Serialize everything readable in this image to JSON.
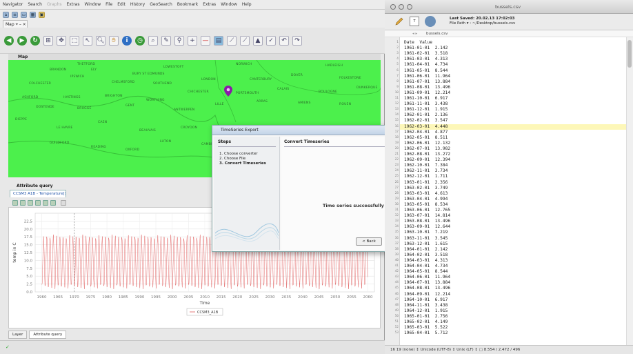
{
  "left_app": {
    "menu": [
      {
        "label": "Navigator",
        "dim": false
      },
      {
        "label": "Search",
        "dim": false
      },
      {
        "label": "Graphs",
        "dim": true
      },
      {
        "label": "Extras",
        "dim": false
      },
      {
        "label": "Window",
        "dim": false
      },
      {
        "label": "File",
        "dim": false
      },
      {
        "label": "Edit",
        "dim": false
      },
      {
        "label": "History",
        "dim": false
      },
      {
        "label": "GeoSearch",
        "dim": false
      },
      {
        "label": "Bookmark",
        "dim": false
      },
      {
        "label": "Extras",
        "dim": false
      },
      {
        "label": "Window",
        "dim": false
      },
      {
        "label": "Help",
        "dim": false
      }
    ],
    "map_tab_label": "Map ⌖ – ×",
    "map_panel_title": "Map",
    "map_places": [
      "THETFORD",
      "LOWESTOFT",
      "NORWICH",
      "HADLEIGH",
      "BRANDON",
      "ELY",
      "BURY ST EDMUNDS",
      "IPSWICH",
      "COLCHESTER",
      "CHELMSFORD",
      "SOUTHEND",
      "LONDON",
      "CANTERBURY",
      "DOVER",
      "FOLKESTONE",
      "ASHFORD",
      "HASTINGS",
      "BRIGHTON",
      "WORTHING",
      "CHICHESTER",
      "PORTSMOUTH",
      "CALAIS",
      "BOULOGNE",
      "DUNKERQUE",
      "OOSTENDE",
      "BRUGGE",
      "GENT",
      "ANTWERPEN",
      "LILLE",
      "ARRAS",
      "AMIENS",
      "ROUEN",
      "DIEPPE",
      "LE HAVRE",
      "CAEN",
      "BEAUVAIS",
      "CROYDON",
      "GUILDFORD",
      "READING",
      "OXFORD",
      "LUTON",
      "CAMBRIDGE"
    ],
    "attribute_query_title": "Attribute query",
    "layer_tab_label": "CCSM3 A1B - Temperature[]",
    "bottom_tabs": [
      "Layer",
      "Attribute query"
    ]
  },
  "chart_data": {
    "type": "line",
    "title": "",
    "xlabel": "Time",
    "ylabel": "temp in C",
    "xlim": [
      1958,
      2062
    ],
    "ylim": [
      0,
      25
    ],
    "x_ticks": [
      1960,
      1965,
      1970,
      1975,
      1980,
      1985,
      1990,
      1995,
      2000,
      2005,
      2010,
      2015,
      2020,
      2025,
      2030,
      2035,
      2040,
      2045,
      2050,
      2055,
      2060
    ],
    "y_ticks": [
      0.0,
      2.5,
      5.0,
      7.5,
      10.0,
      12.5,
      15.0,
      17.5,
      20.0,
      22.5
    ],
    "y_tick_labels": [
      "0.0",
      "2.5",
      "5.0",
      "7.5",
      "10.0",
      "12.5",
      "15.0",
      "17.5",
      "20.0",
      "22.5"
    ],
    "grid": true,
    "vertical_marker_x": 1970,
    "legend": {
      "position": "bottom-center",
      "entries": [
        "CCSM3_A1B"
      ]
    },
    "series": [
      {
        "name": "CCSM3_A1B",
        "color": "#e05a5a",
        "x_start": 1960,
        "x_end": 2060,
        "period_years": 1,
        "monthly_profile_min": [
          2.1,
          2.4,
          3.5,
          3.7,
          4.3,
          4.7
        ],
        "monthly_profile_max": [
          13.9,
          14.8,
          16.5,
          17.2
        ],
        "amplitude_min": 1.6,
        "amplitude_max": 17.5
      }
    ]
  },
  "dialog": {
    "title": "TimeSeries Export",
    "steps_title": "Steps",
    "steps": [
      "Choose converter",
      "Choose File",
      "Convert Timeseries"
    ],
    "active_step_index": 2,
    "content_title": "Convert Timeseries",
    "success_message": "Time series successfully exp",
    "back_button": "< Back"
  },
  "right_app": {
    "window_title": "bussels.csv",
    "last_saved": "Last Saved: 20.02.13 17:02:03",
    "file_path": "File Path ▾ : ~/Desktop/bussels.csv",
    "nav_file": "bussels.csv",
    "highlight_line": 16,
    "lines": [
      {
        "n": "1",
        "text": "Date  Value"
      },
      {
        "n": "2",
        "text": "1961-01-01  2.142"
      },
      {
        "n": "3",
        "text": "1961-02-01  3.518"
      },
      {
        "n": "4",
        "text": "1961-03-01  4.313"
      },
      {
        "n": "5",
        "text": "1961-04-01  4.734"
      },
      {
        "n": "6",
        "text": "1961-05-01  8.544"
      },
      {
        "n": "7",
        "text": "1961-06-01  11.964"
      },
      {
        "n": "8",
        "text": "1961-07-01  13.884"
      },
      {
        "n": "9",
        "text": "1961-08-01  13.496"
      },
      {
        "n": "10",
        "text": "1961-09-01  12.214"
      },
      {
        "n": "11",
        "text": "1961-10-01  6.917"
      },
      {
        "n": "12",
        "text": "1961-11-01  3.438"
      },
      {
        "n": "13",
        "text": "1961-12-01  1.915"
      },
      {
        "n": "14",
        "text": "1962-01-01  2.136"
      },
      {
        "n": "15",
        "text": "1962-02-01  3.547"
      },
      {
        "n": "16",
        "text": "1962-03-01  4.448"
      },
      {
        "n": "17",
        "text": "1962-04-01  4.877"
      },
      {
        "n": "18",
        "text": "1962-05-01  8.511"
      },
      {
        "n": "19",
        "text": "1962-06-01  12.132"
      },
      {
        "n": "20",
        "text": "1962-07-01  13.982"
      },
      {
        "n": "21",
        "text": "1962-08-01  13.272"
      },
      {
        "n": "22",
        "text": "1962-09-01  12.394"
      },
      {
        "n": "23",
        "text": "1962-10-01  7.384"
      },
      {
        "n": "24",
        "text": "1962-11-01  3.734"
      },
      {
        "n": "25",
        "text": "1962-12-01  1.711"
      },
      {
        "n": "26",
        "text": "1963-01-01  2.356"
      },
      {
        "n": "27",
        "text": "1963-02-01  3.749"
      },
      {
        "n": "28",
        "text": "1963-03-01  4.613"
      },
      {
        "n": "29",
        "text": "1963-04-01  4.994"
      },
      {
        "n": "30",
        "text": "1963-05-01  8.534"
      },
      {
        "n": "31",
        "text": "1963-06-01  12.765"
      },
      {
        "n": "32",
        "text": "1963-07-01  14.814"
      },
      {
        "n": "33",
        "text": "1963-08-01  13.496"
      },
      {
        "n": "34",
        "text": "1963-09-01  12.644"
      },
      {
        "n": "35",
        "text": "1963-10-01  7.219"
      },
      {
        "n": "36",
        "text": "1963-11-01  3.545"
      },
      {
        "n": "37",
        "text": "1963-12-01  1.615"
      },
      {
        "n": "38",
        "text": "1964-01-01  2.142"
      },
      {
        "n": "39",
        "text": "1964-02-01  3.518"
      },
      {
        "n": "40",
        "text": "1964-03-01  4.313"
      },
      {
        "n": "41",
        "text": "1964-04-01  4.734"
      },
      {
        "n": "42",
        "text": "1964-05-01  8.544"
      },
      {
        "n": "43",
        "text": "1964-06-01  11.964"
      },
      {
        "n": "44",
        "text": "1964-07-01  13.884"
      },
      {
        "n": "45",
        "text": "1964-08-01  13.496"
      },
      {
        "n": "46",
        "text": "1964-09-01  12.214"
      },
      {
        "n": "47",
        "text": "1964-10-01  6.917"
      },
      {
        "n": "48",
        "text": "1964-11-01  3.438"
      },
      {
        "n": "49",
        "text": "1964-12-01  1.915"
      },
      {
        "n": "50",
        "text": "1965-01-01  2.756"
      },
      {
        "n": "51",
        "text": "1965-02-01  4.149"
      },
      {
        "n": "52",
        "text": "1965-03-01  5.522"
      },
      {
        "n": "53",
        "text": "1965-04-01  5.712"
      }
    ],
    "status_bar": "16  19      (none)  ↕  Unicode (UTF-8)  ↕  Unix (LF)  ↕  ▢ 8.554 / 2.472 / 496"
  },
  "colors": {
    "map_green": "#4cf04c",
    "series_red": "#e05a5a",
    "highlight_yellow": "#fdf7b8"
  }
}
